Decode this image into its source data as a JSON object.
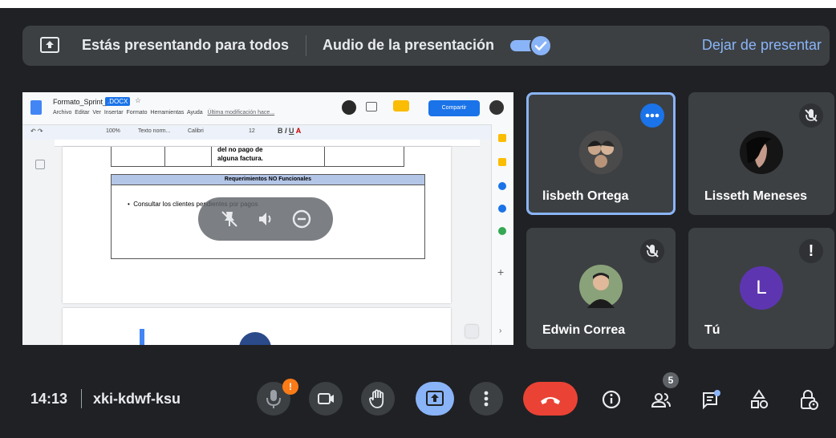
{
  "banner": {
    "presenting_text": "Estás presentando para todos",
    "audio_label": "Audio de la presentación",
    "audio_enabled": true,
    "stop_label": "Dejar de presentar"
  },
  "shared_screen": {
    "doc_title": "Formato_Sprint_1",
    "doc_ext": ".DOCX",
    "menus": [
      "Archivo",
      "Editar",
      "Ver",
      "Insertar",
      "Formato",
      "Herramientas",
      "Ayuda"
    ],
    "last_modified": "Última modificación hace...",
    "share_label": "Compartir",
    "toolbar_zoom": "100%",
    "toolbar_style": "Texto norm...",
    "toolbar_font": "Calibri",
    "toolbar_size": "12",
    "cell_text_1": "del no pago de",
    "cell_text_2": "alguna factura.",
    "nf_header": "Requerimientos NO Funcionales",
    "nf_item": "Consultar los clientes pendientes por pagos"
  },
  "participants": [
    {
      "name": "lisbeth Ortega",
      "speaking_outline": true,
      "avatar_color": "#6d6d6d"
    },
    {
      "name": "Lisseth Meneses",
      "muted": true,
      "avatar_color": "#1c1c1c"
    },
    {
      "name": "Edwin Correa",
      "muted": true,
      "avatar_color": "#7a8a5c"
    },
    {
      "name": "Tú",
      "initial": "L",
      "avatar_color": "#5e35b1",
      "alert": "!"
    }
  ],
  "meeting": {
    "time": "14:13",
    "code": "xki-kdwf-ksu",
    "participants_count": "5",
    "mic_alert": "!"
  },
  "colors": {
    "accent": "#8ab4f8",
    "blue": "#1a73e8",
    "hangup": "#ea4335",
    "alert": "#fa7b17"
  }
}
